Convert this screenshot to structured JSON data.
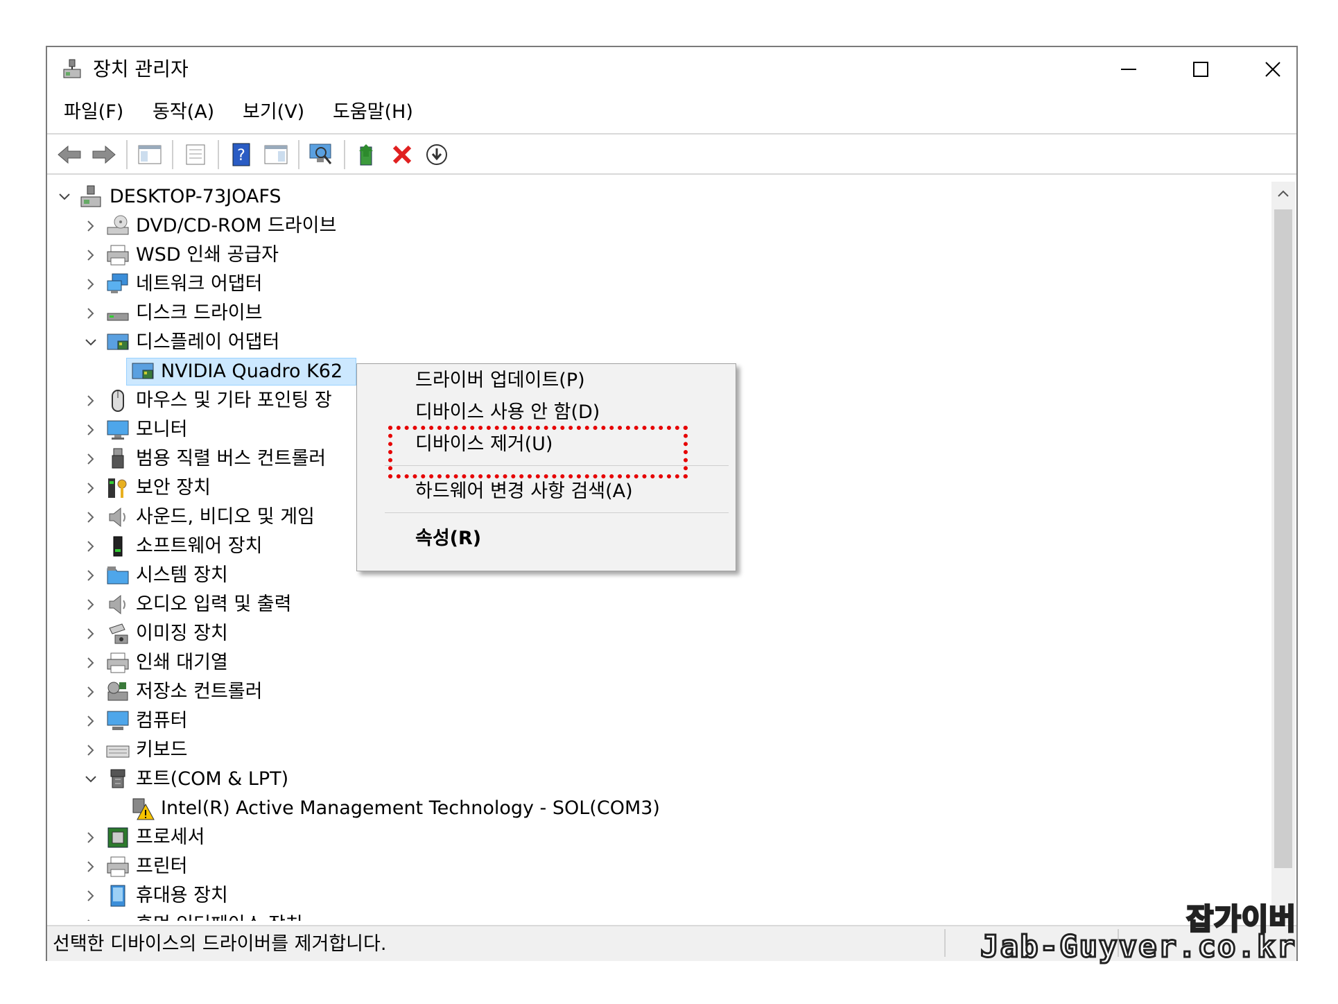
{
  "window": {
    "title": "장치 관리자"
  },
  "menubar": [
    "파일(F)",
    "동작(A)",
    "보기(V)",
    "도움말(H)"
  ],
  "toolbar": [
    "back-icon",
    "forward-icon",
    "console-tree-icon",
    "properties-icon",
    "help-icon",
    "action-pane-icon",
    "scan-hardware-icon",
    "update-driver-icon",
    "uninstall-icon",
    "download-icon"
  ],
  "tree": {
    "root": "DESKTOP-73JOAFS",
    "items": [
      {
        "label": "DVD/CD-ROM 드라이브",
        "icon": "dvd-drive-icon",
        "expanded": false
      },
      {
        "label": "WSD 인쇄 공급자",
        "icon": "printer-icon",
        "expanded": false
      },
      {
        "label": "네트워크 어댑터",
        "icon": "network-adapter-icon",
        "expanded": false
      },
      {
        "label": "디스크 드라이브",
        "icon": "disk-drive-icon",
        "expanded": false
      },
      {
        "label": "디스플레이 어댑터",
        "icon": "display-adapter-icon",
        "expanded": true
      },
      {
        "label": "NVIDIA Quadro K62",
        "icon": "display-adapter-icon",
        "child": true,
        "selected": true
      },
      {
        "label": "마우스 및 기타 포인팅 장",
        "icon": "mouse-icon",
        "expanded": false
      },
      {
        "label": "모니터",
        "icon": "monitor-icon",
        "expanded": false
      },
      {
        "label": "범용 직렬 버스 컨트롤러",
        "icon": "usb-icon",
        "expanded": false
      },
      {
        "label": "보안 장치",
        "icon": "security-key-icon",
        "expanded": false
      },
      {
        "label": "사운드, 비디오 및 게임",
        "icon": "speaker-icon",
        "expanded": false
      },
      {
        "label": "소프트웨어 장치",
        "icon": "software-device-icon",
        "expanded": false
      },
      {
        "label": "시스템 장치",
        "icon": "system-folder-icon",
        "expanded": false
      },
      {
        "label": "오디오 입력 및 출력",
        "icon": "speaker-icon",
        "expanded": false
      },
      {
        "label": "이미징 장치",
        "icon": "camera-icon",
        "expanded": false
      },
      {
        "label": "인쇄 대기열",
        "icon": "printer-icon",
        "expanded": false
      },
      {
        "label": "저장소 컨트롤러",
        "icon": "storage-controller-icon",
        "expanded": false
      },
      {
        "label": "컴퓨터",
        "icon": "computer-icon",
        "expanded": false
      },
      {
        "label": "키보드",
        "icon": "keyboard-icon",
        "expanded": false
      },
      {
        "label": "포트(COM & LPT)",
        "icon": "port-icon",
        "expanded": true
      },
      {
        "label": "Intel(R) Active Management Technology - SOL(COM3)",
        "icon": "warning-port-icon",
        "child": true
      },
      {
        "label": "프로세서",
        "icon": "processor-icon",
        "expanded": false
      },
      {
        "label": "프린터",
        "icon": "printer-icon",
        "expanded": false
      },
      {
        "label": "휴대용 장치",
        "icon": "portable-device-icon",
        "expanded": false
      },
      {
        "label": "휴먼 인터페이스 장치",
        "icon": "hid-icon",
        "expanded": false
      }
    ]
  },
  "context_menu": {
    "items": [
      "드라이버 업데이트(P)",
      "디바이스 사용 안 함(D)",
      "디바이스 제거(U)",
      "하드웨어 변경 사항 검색(A)",
      "속성(R)"
    ]
  },
  "status": {
    "text": "선택한 디바이스의 드라이버를 제거합니다."
  },
  "watermark": {
    "korean": "잡가이버",
    "url": "Jab-Guyver.co.kr"
  },
  "colors": {
    "selection": "#cce8ff",
    "highlight_border": "#e60000",
    "accent_icon": "#1a73c8"
  }
}
